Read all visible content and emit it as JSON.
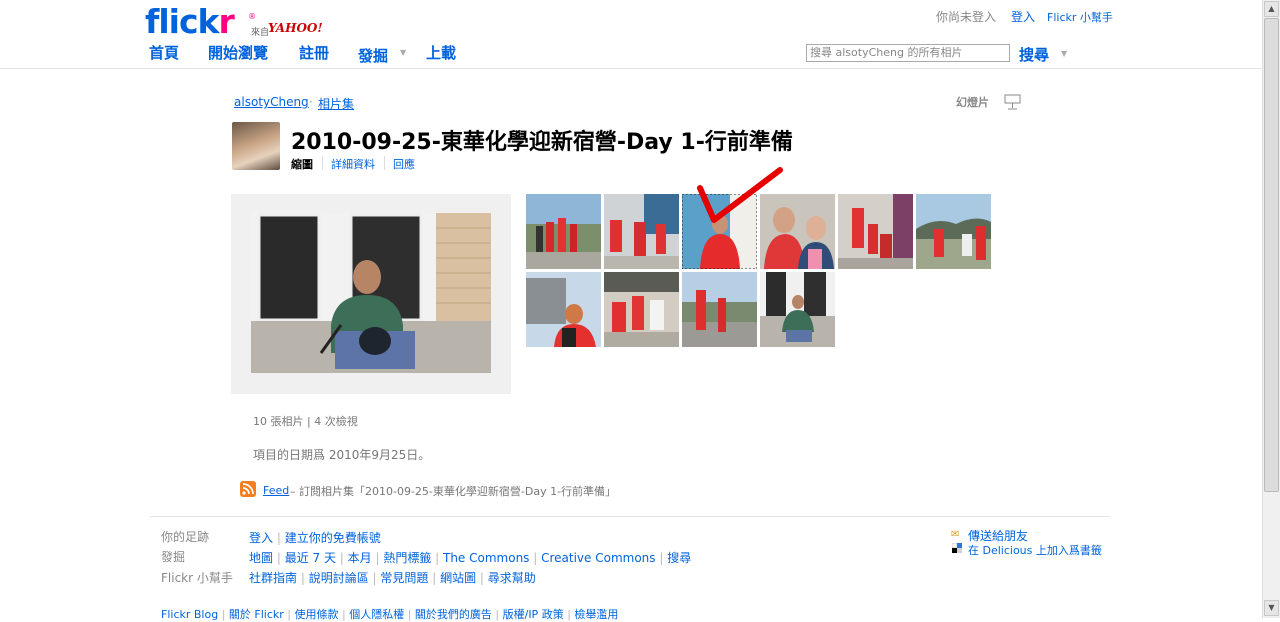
{
  "header": {
    "logo_text_blue": "flick",
    "logo_text_pink": "r",
    "logo_reg": "®",
    "logo_from": "來自",
    "logo_yahoo": "YAHOO!",
    "nav": [
      "首頁",
      "開始瀏覽",
      "註冊",
      "發掘",
      "上載"
    ],
    "status_text": "你尚未登入",
    "login_link": "登入",
    "help_link": "Flickr 小幫手",
    "search_placeholder": "搜尋 alsotyCheng 的所有相片",
    "search_button": "搜尋"
  },
  "set": {
    "owner": "alsotyCheng",
    "crumb_sep": "·",
    "crumb_sets": "相片集",
    "slideshow": "幻燈片",
    "title": "2010-09-25-東華化學迎新宿營-Day 1-行前準備",
    "tabs": [
      "縮圖",
      "詳細資料",
      "回應"
    ],
    "stats": "10 張相片 | 4 次檢視",
    "date_text": "項目的日期爲 2010年9月25日。",
    "feed_link": "Feed",
    "feed_text": "– 訂閱相片集「2010-09-25-東華化學迎新宿營-Day 1-行前準備」"
  },
  "footer": {
    "labels": [
      "你的足跡",
      "發掘",
      "Flickr 小幫手"
    ],
    "row1": [
      "登入",
      "建立你的免費帳號"
    ],
    "row2": [
      "地圖",
      "最近 7 天",
      "本月",
      "熱門標籤",
      "The Commons",
      "Creative Commons",
      "搜尋"
    ],
    "row3": [
      "社群指南",
      "說明討論區",
      "常見問題",
      "網站圖",
      "尋求幫助"
    ],
    "row4": [
      "Flickr Blog",
      "關於 Flickr",
      "使用條款",
      "個人隱私權",
      "關於我們的廣告",
      "版權/IP 政策",
      "檢舉濫用"
    ],
    "send_friend": "傳送給朋友",
    "delicious": "在 Delicious 上加入爲書籤"
  },
  "colors": {
    "link": "#0063dc",
    "pink": "#ff0084",
    "panel": "#f0f0f0"
  }
}
